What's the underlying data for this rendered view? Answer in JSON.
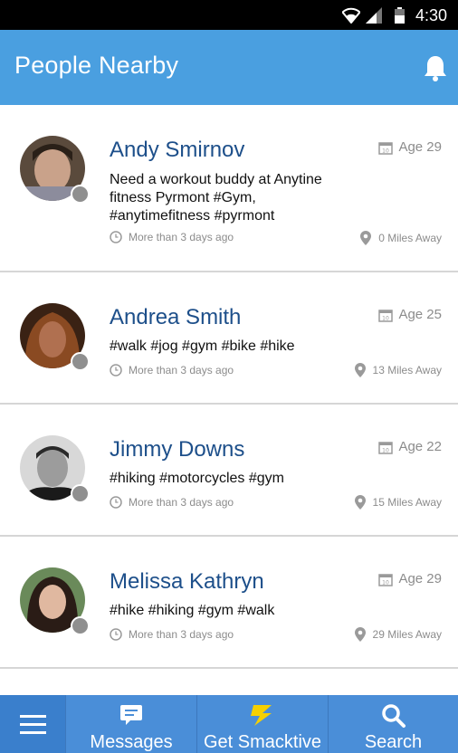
{
  "status_bar": {
    "time": "4:30",
    "icons": [
      "wifi-icon",
      "signal-icon",
      "battery-icon"
    ]
  },
  "app_bar": {
    "title": "People Nearby",
    "icon": "bell-icon"
  },
  "colors": {
    "app_bar": "#4a9fe0",
    "bottom_nav": "#4a8ed8",
    "name": "#1d4f8a",
    "bolt": "#f5d000"
  },
  "people": [
    {
      "name": "Andy Smirnov",
      "age": "Age 29",
      "description": "Need a workout buddy at Anytine fitness Pyrmont #Gym, #anytimefitness #pyrmont",
      "last_seen": "More than 3 days ago",
      "distance": "0 Miles Away"
    },
    {
      "name": "Andrea Smith",
      "age": "Age 25",
      "description": "#walk #jog #gym #bike #hike",
      "last_seen": "More than 3 days ago",
      "distance": "13 Miles Away"
    },
    {
      "name": "Jimmy Downs",
      "age": "Age 22",
      "description": "#hiking #motorcycles #gym",
      "last_seen": "More than 3 days ago",
      "distance": "15 Miles Away"
    },
    {
      "name": "Melissa Kathryn",
      "age": "Age 29",
      "description": "#hike #hiking #gym #walk",
      "last_seen": "More than 3 days ago",
      "distance": "29 Miles Away"
    }
  ],
  "bottom_nav": {
    "menu_icon": "menu-icon",
    "items": [
      {
        "label": "Messages",
        "icon": "chat-icon"
      },
      {
        "label": "Get Smacktive",
        "icon": "bolt-icon"
      },
      {
        "label": "Search",
        "icon": "search-icon"
      }
    ]
  }
}
